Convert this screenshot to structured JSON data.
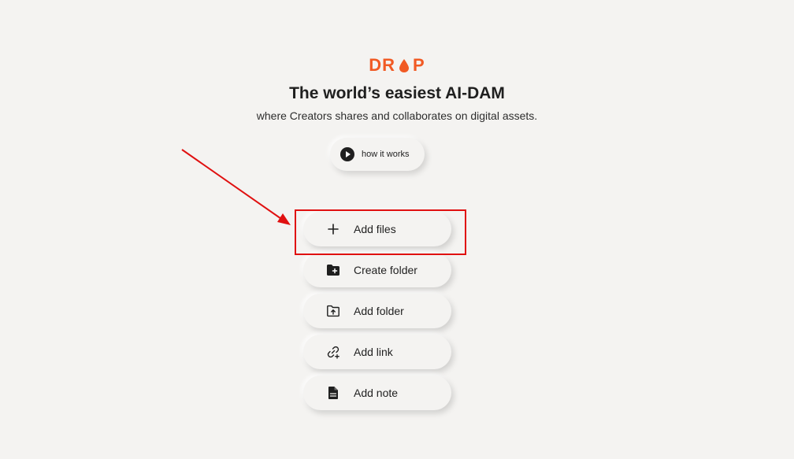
{
  "brand": {
    "logo_left": "DR",
    "logo_right": "P",
    "accent_color": "#f15a24"
  },
  "hero": {
    "title": "The world’s easiest AI-DAM",
    "subtitle": "where Creators shares and collaborates on digital assets."
  },
  "how_it_works": {
    "label": "how it works",
    "icon": "play-icon"
  },
  "actions": [
    {
      "label": "Add files",
      "icon": "plus-icon"
    },
    {
      "label": "Create folder",
      "icon": "folder-plus-icon"
    },
    {
      "label": "Add folder",
      "icon": "folder-upload-icon"
    },
    {
      "label": "Add link",
      "icon": "link-add-icon"
    },
    {
      "label": "Add note",
      "icon": "note-icon"
    }
  ],
  "annotation": {
    "color": "#e01010"
  }
}
